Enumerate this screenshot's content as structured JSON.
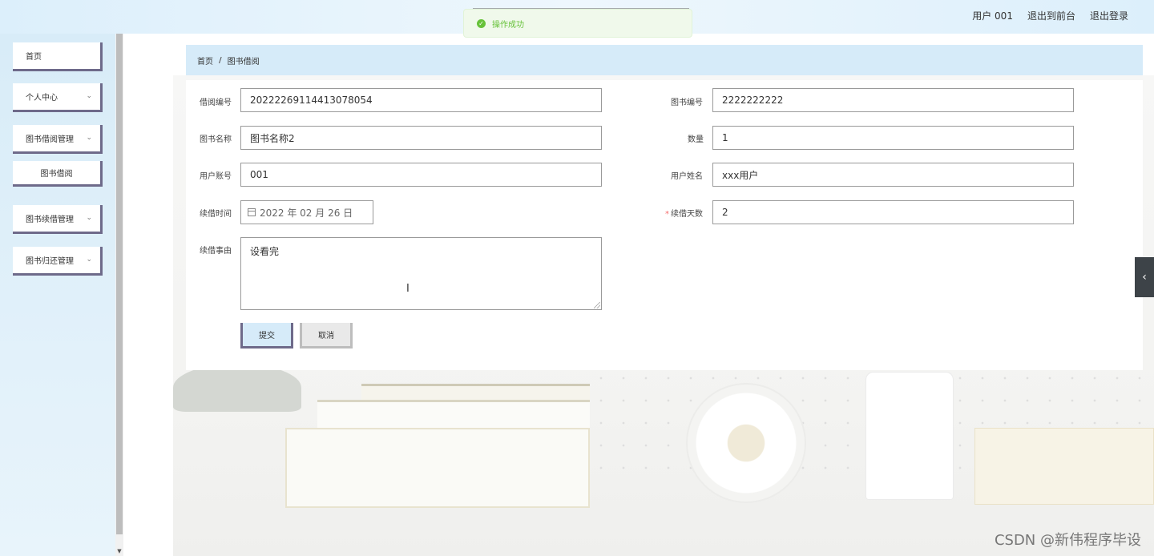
{
  "header": {
    "user_label": "用户 001",
    "back_to_front": "退出到前台",
    "logout": "退出登录"
  },
  "toast": {
    "message": "操作成功",
    "color": "#67c23a"
  },
  "sidebar": {
    "items": [
      {
        "label": "首页"
      },
      {
        "label": "个人中心"
      },
      {
        "label": "图书借阅管理"
      },
      {
        "label": "图书借阅"
      },
      {
        "label": "图书续借管理"
      },
      {
        "label": "图书归还管理"
      }
    ],
    "chevron": "⌄"
  },
  "breadcrumb": {
    "home": "首页",
    "separator": "/",
    "current": "图书借阅"
  },
  "form": {
    "borrow_no": {
      "label": "借阅编号",
      "value": "20222269114413078054"
    },
    "book_no": {
      "label": "图书编号",
      "value": "2222222222"
    },
    "book_name": {
      "label": "图书名称",
      "value": "图书名称2"
    },
    "quantity": {
      "label": "数量",
      "value": "1"
    },
    "user_account": {
      "label": "用户账号",
      "value": "001"
    },
    "user_name": {
      "label": "用户姓名",
      "value": "xxx用户"
    },
    "renew_time": {
      "label": "续借时间",
      "value": "2022 年 02 月 26 日"
    },
    "renew_days": {
      "label": "续借天数",
      "required_mark": "*",
      "value": "2"
    },
    "renew_reason": {
      "label": "续借事由",
      "value": "设看完"
    },
    "submit_label": "提交",
    "cancel_label": "取消"
  },
  "side_toggle": "‹",
  "watermark": "CSDN @新伟程序毕设",
  "colors": {
    "accent": "#d6ebf9",
    "menu_border": "#6e6a8a",
    "success": "#67c23a"
  }
}
